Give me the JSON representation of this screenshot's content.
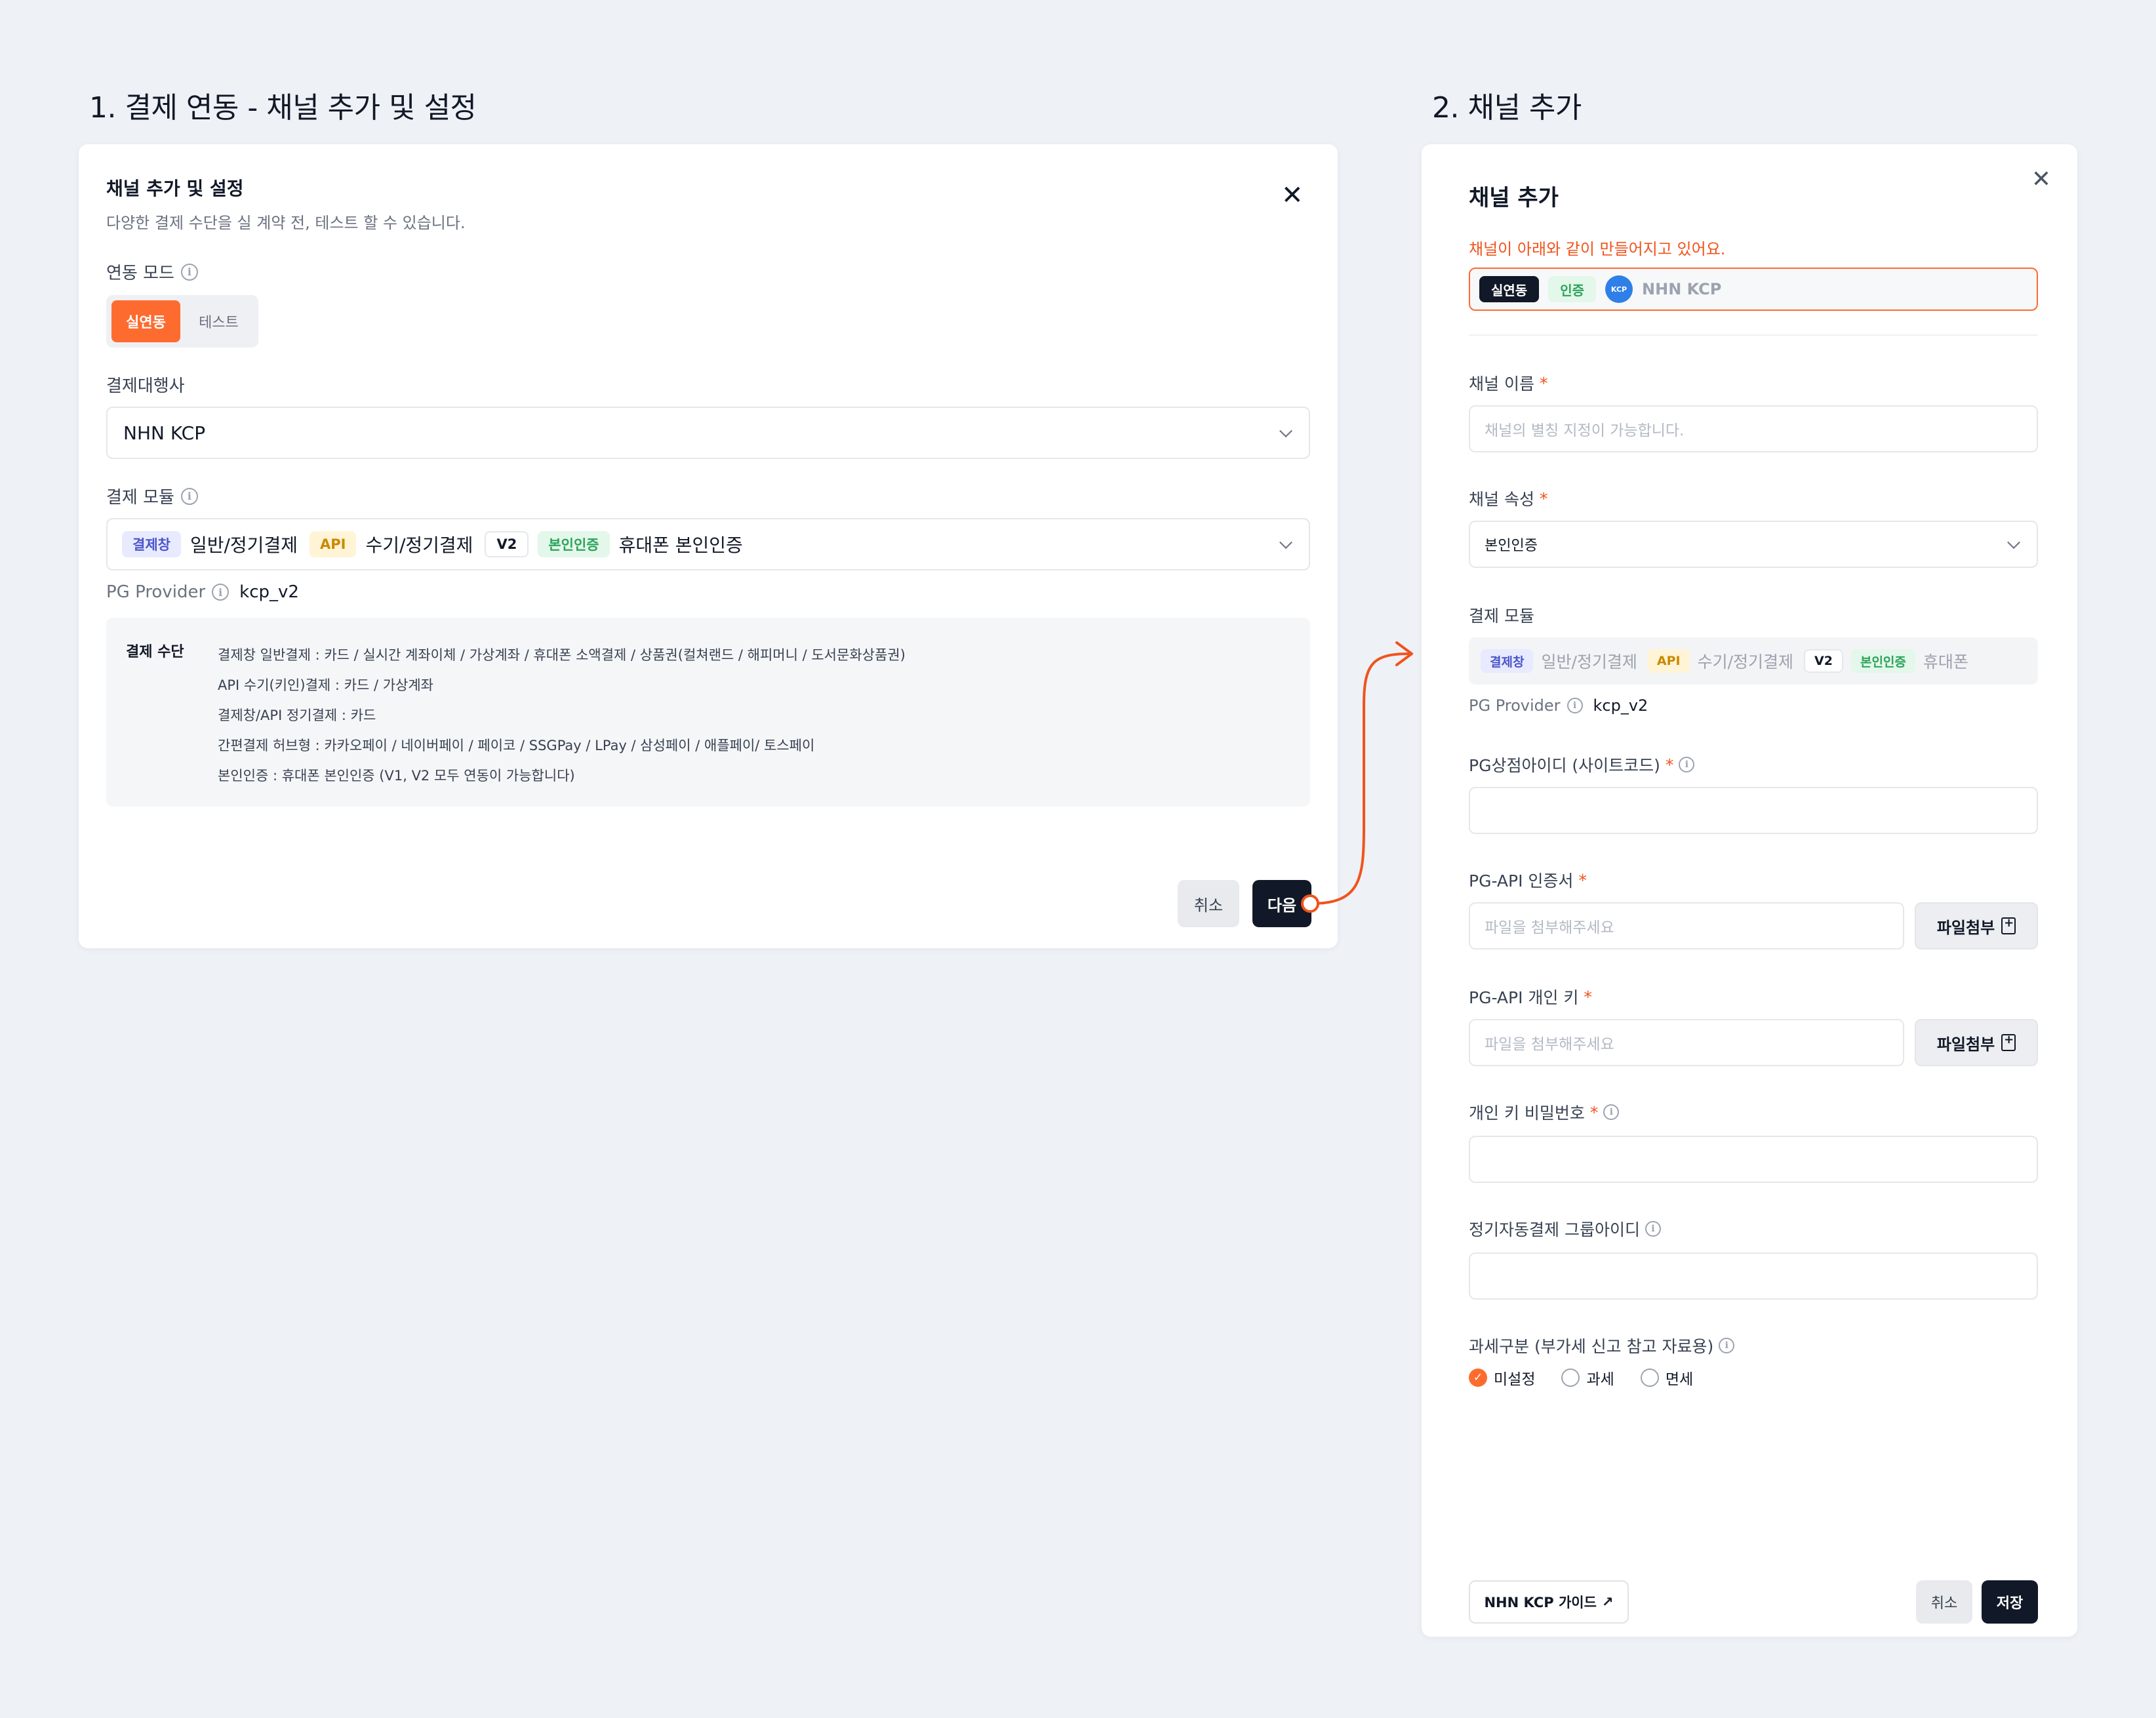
{
  "sections": {
    "left_title": "1. 결제 연동 - 채널 추가 및 설정",
    "right_title": "2. 채널 추가"
  },
  "left_modal": {
    "title": "채널 추가 및 설정",
    "subtitle": "다양한 결제 수단을 실 계약 전, 테스트 할 수 있습니다.",
    "mode_label": "연동 모드",
    "mode_options": [
      "실연동",
      "테스트"
    ],
    "mode_selected": "실연동",
    "pg_label": "결제대행사",
    "pg_value": "NHN KCP",
    "module_label": "결제 모듈",
    "module_tags": [
      {
        "tag": "결제창",
        "text": "일반/정기결제"
      },
      {
        "tag": "API",
        "text": "수기/정기결제"
      },
      {
        "tag": "V2",
        "text": ""
      },
      {
        "tag": "본인인증",
        "text": "휴대폰 본인인증"
      }
    ],
    "provider_label": "PG Provider",
    "provider_value": "kcp_v2",
    "methods_head": "결제 수단",
    "methods": [
      "결제창 일반결제 : 카드 / 실시간 계좌이체 / 가상계좌 / 휴대폰 소액결제 / 상품권(컬쳐랜드 / 해피머니 / 도서문화상품권)",
      "API 수기(키인)결제 : 카드 / 가상계좌",
      "결제창/API 정기결제 : 카드",
      "간편결제 허브형 : 카카오페이 / 네이버페이 / 페이코 / SSGPay / LPay / 삼성페이 / 애플페이/ 토스페이",
      "본인인증 : 휴대폰 본인인증 (V1, V2 모두 연동이 가능합니다)"
    ],
    "cancel_label": "취소",
    "next_label": "다음"
  },
  "right_panel": {
    "title": "채널 추가",
    "notice": "채널이 아래와 같이 만들어지고 있어요.",
    "preview": {
      "mode": "실연동",
      "type": "인증",
      "logo_text": "KCP",
      "pg_name": "NHN KCP"
    },
    "channel_name_label": "채널 이름",
    "channel_name_placeholder": "채널의 별칭 지정이 가능합니다.",
    "channel_attr_label": "채널 속성",
    "channel_attr_value": "본인인증",
    "module_label": "결제 모듈",
    "module_tags": [
      {
        "tag": "결제창",
        "text": "일반/정기결제"
      },
      {
        "tag": "API",
        "text": "수기/정기결제"
      },
      {
        "tag": "V2",
        "text": ""
      },
      {
        "tag": "본인인증",
        "text": "휴대폰"
      }
    ],
    "provider_label": "PG Provider",
    "provider_value": "kcp_v2",
    "site_code_label": "PG상점아이디 (사이트코드)",
    "cert_label": "PG-API 인증서",
    "cert_placeholder": "파일을 첨부해주세요",
    "private_key_label": "PG-API 개인 키",
    "private_key_placeholder": "파일을 첨부해주세요",
    "attach_label": "파일첨부",
    "key_password_label": "개인 키 비밀번호",
    "group_id_label": "정기자동결제 그룹아이디",
    "tax_label": "과세구분 (부가세 신고 참고 자료용)",
    "tax_options": [
      "미설정",
      "과세",
      "면세"
    ],
    "tax_selected": "미설정",
    "guide_label": "NHN KCP 가이드",
    "cancel_label": "취소",
    "save_label": "저장"
  },
  "colors": {
    "accent": "#fe6b2f",
    "dark": "#111827",
    "background": "#eef1f6"
  }
}
